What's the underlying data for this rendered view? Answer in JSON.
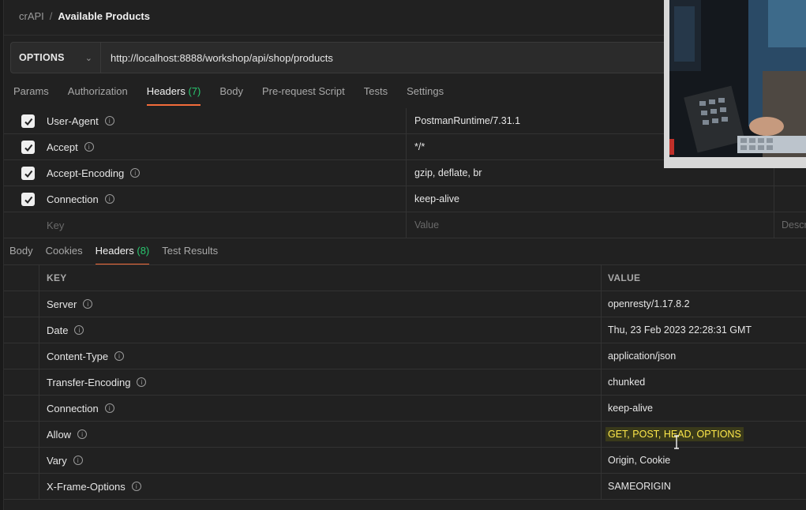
{
  "breadcrumb": {
    "collection": "crAPI",
    "separator": "/",
    "request": "Available Products"
  },
  "request": {
    "method": "OPTIONS",
    "url": "http://localhost:8888/workshop/api/shop/products"
  },
  "request_tabs": [
    {
      "label": "Params",
      "count": ""
    },
    {
      "label": "Authorization",
      "count": ""
    },
    {
      "label": "Headers",
      "count": "(7)",
      "active": true
    },
    {
      "label": "Body",
      "count": ""
    },
    {
      "label": "Pre-request Script",
      "count": ""
    },
    {
      "label": "Tests",
      "count": ""
    },
    {
      "label": "Settings",
      "count": ""
    }
  ],
  "request_headers": [
    {
      "key": "User-Agent",
      "value": "PostmanRuntime/7.31.1"
    },
    {
      "key": "Accept",
      "value": "*/*"
    },
    {
      "key": "Accept-Encoding",
      "value": "gzip, deflate, br"
    },
    {
      "key": "Connection",
      "value": "keep-alive"
    }
  ],
  "request_placeholder": {
    "key": "Key",
    "value": "Value",
    "description": "Descri"
  },
  "response_tabs": [
    {
      "label": "Body",
      "count": ""
    },
    {
      "label": "Cookies",
      "count": ""
    },
    {
      "label": "Headers",
      "count": "(8)",
      "active": true
    },
    {
      "label": "Test Results",
      "count": ""
    }
  ],
  "response_columns": {
    "key": "KEY",
    "value": "VALUE"
  },
  "response_headers": [
    {
      "key": "Server",
      "value": "openresty/1.17.8.2"
    },
    {
      "key": "Date",
      "value": "Thu, 23 Feb 2023 22:28:31 GMT"
    },
    {
      "key": "Content-Type",
      "value": "application/json"
    },
    {
      "key": "Transfer-Encoding",
      "value": "chunked"
    },
    {
      "key": "Connection",
      "value": "keep-alive"
    },
    {
      "key": "Allow",
      "value": "GET, POST, HEAD, OPTIONS",
      "highlighted": true
    },
    {
      "key": "Vary",
      "value": "Origin, Cookie"
    },
    {
      "key": "X-Frame-Options",
      "value": "SAMEORIGIN"
    }
  ],
  "colors": {
    "accent": "#f26b3a",
    "count": "#29c76f",
    "highlight": "#ffe94a"
  }
}
